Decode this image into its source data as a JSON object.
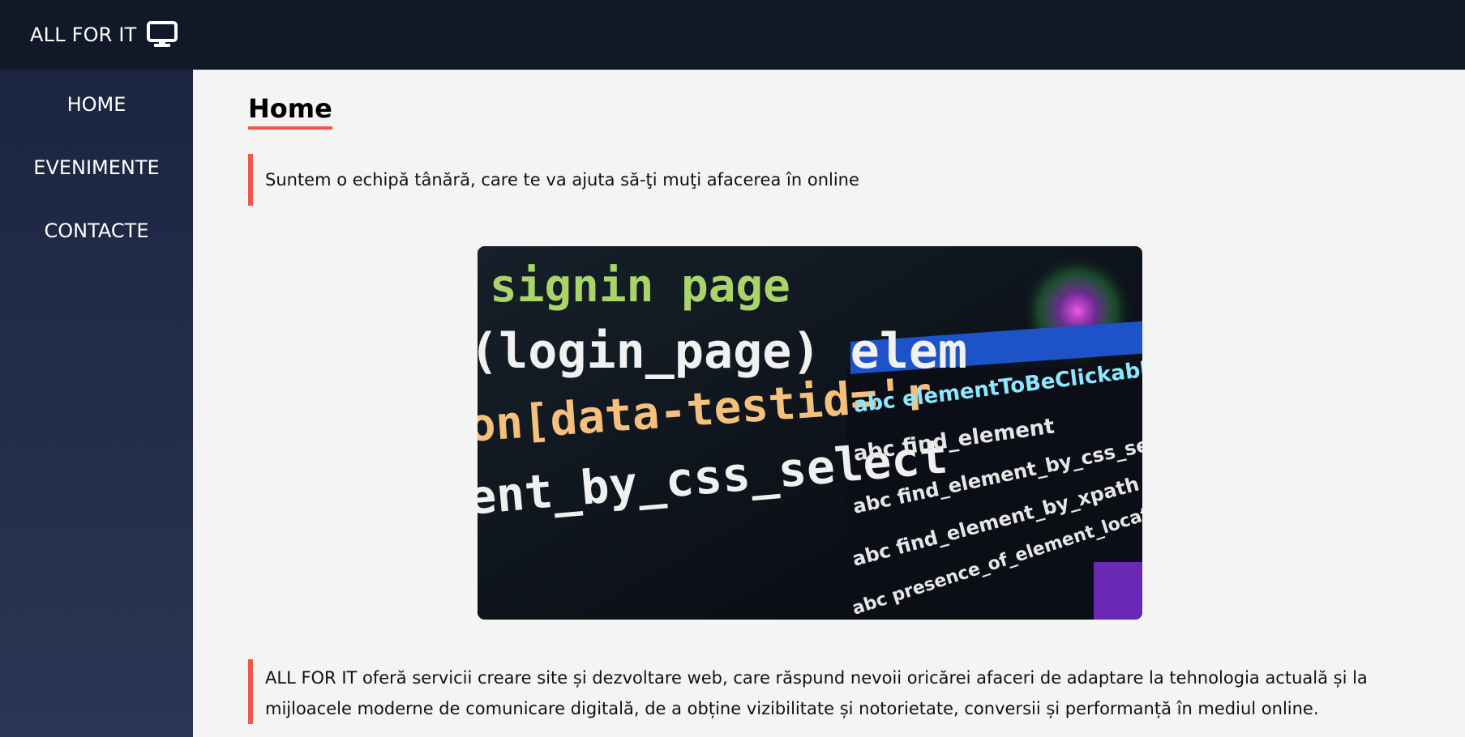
{
  "header": {
    "brand": "ALL FOR IT",
    "brand_icon": "monitor-icon"
  },
  "sidebar": {
    "items": [
      {
        "label": "HOME"
      },
      {
        "label": "EVENIMENTE"
      },
      {
        "label": "CONTACTE"
      }
    ]
  },
  "main": {
    "title": "Home",
    "intro": "Suntem o echipă tânără, care te va ajuta să-ţi muţi afacerea în online",
    "description": "ALL FOR IT oferă servicii creare site și dezvoltare web, care răspund nevoii oricărei afaceri de adaptare la tehnologia actuală și la mijloacele moderne de comunicare digitală, de a obține vizibilitate și notorietate, conversii și performanță în mediul online."
  },
  "hero_image": {
    "code_lines": [
      "signin page",
      "(login_page) elem",
      "on[data-testid='r",
      "ent_by_css_select"
    ],
    "autocomplete": [
      "abc elementToBeClickable",
      "abc find_element",
      "abc find_element_by_css_selector",
      "abc find_element_by_xpath",
      "abc presence_of_element_located"
    ]
  },
  "colors": {
    "topbar": "#111827",
    "sidebar": "#1f2945",
    "accent": "#f2574a",
    "background": "#f4f4f4"
  }
}
